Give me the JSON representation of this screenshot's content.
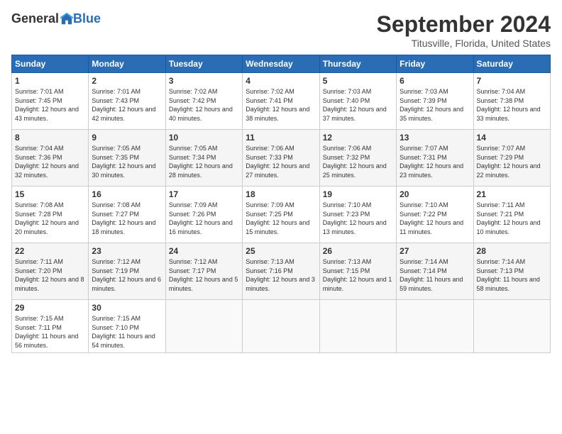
{
  "logo": {
    "general": "General",
    "blue": "Blue"
  },
  "header": {
    "month": "September 2024",
    "location": "Titusville, Florida, United States"
  },
  "days_of_week": [
    "Sunday",
    "Monday",
    "Tuesday",
    "Wednesday",
    "Thursday",
    "Friday",
    "Saturday"
  ],
  "weeks": [
    [
      {
        "day": "1",
        "sunrise": "7:01 AM",
        "sunset": "7:45 PM",
        "daylight": "12 hours and 43 minutes."
      },
      {
        "day": "2",
        "sunrise": "7:01 AM",
        "sunset": "7:43 PM",
        "daylight": "12 hours and 42 minutes."
      },
      {
        "day": "3",
        "sunrise": "7:02 AM",
        "sunset": "7:42 PM",
        "daylight": "12 hours and 40 minutes."
      },
      {
        "day": "4",
        "sunrise": "7:02 AM",
        "sunset": "7:41 PM",
        "daylight": "12 hours and 38 minutes."
      },
      {
        "day": "5",
        "sunrise": "7:03 AM",
        "sunset": "7:40 PM",
        "daylight": "12 hours and 37 minutes."
      },
      {
        "day": "6",
        "sunrise": "7:03 AM",
        "sunset": "7:39 PM",
        "daylight": "12 hours and 35 minutes."
      },
      {
        "day": "7",
        "sunrise": "7:04 AM",
        "sunset": "7:38 PM",
        "daylight": "12 hours and 33 minutes."
      }
    ],
    [
      {
        "day": "8",
        "sunrise": "7:04 AM",
        "sunset": "7:36 PM",
        "daylight": "12 hours and 32 minutes."
      },
      {
        "day": "9",
        "sunrise": "7:05 AM",
        "sunset": "7:35 PM",
        "daylight": "12 hours and 30 minutes."
      },
      {
        "day": "10",
        "sunrise": "7:05 AM",
        "sunset": "7:34 PM",
        "daylight": "12 hours and 28 minutes."
      },
      {
        "day": "11",
        "sunrise": "7:06 AM",
        "sunset": "7:33 PM",
        "daylight": "12 hours and 27 minutes."
      },
      {
        "day": "12",
        "sunrise": "7:06 AM",
        "sunset": "7:32 PM",
        "daylight": "12 hours and 25 minutes."
      },
      {
        "day": "13",
        "sunrise": "7:07 AM",
        "sunset": "7:31 PM",
        "daylight": "12 hours and 23 minutes."
      },
      {
        "day": "14",
        "sunrise": "7:07 AM",
        "sunset": "7:29 PM",
        "daylight": "12 hours and 22 minutes."
      }
    ],
    [
      {
        "day": "15",
        "sunrise": "7:08 AM",
        "sunset": "7:28 PM",
        "daylight": "12 hours and 20 minutes."
      },
      {
        "day": "16",
        "sunrise": "7:08 AM",
        "sunset": "7:27 PM",
        "daylight": "12 hours and 18 minutes."
      },
      {
        "day": "17",
        "sunrise": "7:09 AM",
        "sunset": "7:26 PM",
        "daylight": "12 hours and 16 minutes."
      },
      {
        "day": "18",
        "sunrise": "7:09 AM",
        "sunset": "7:25 PM",
        "daylight": "12 hours and 15 minutes."
      },
      {
        "day": "19",
        "sunrise": "7:10 AM",
        "sunset": "7:23 PM",
        "daylight": "12 hours and 13 minutes."
      },
      {
        "day": "20",
        "sunrise": "7:10 AM",
        "sunset": "7:22 PM",
        "daylight": "12 hours and 11 minutes."
      },
      {
        "day": "21",
        "sunrise": "7:11 AM",
        "sunset": "7:21 PM",
        "daylight": "12 hours and 10 minutes."
      }
    ],
    [
      {
        "day": "22",
        "sunrise": "7:11 AM",
        "sunset": "7:20 PM",
        "daylight": "12 hours and 8 minutes."
      },
      {
        "day": "23",
        "sunrise": "7:12 AM",
        "sunset": "7:19 PM",
        "daylight": "12 hours and 6 minutes."
      },
      {
        "day": "24",
        "sunrise": "7:12 AM",
        "sunset": "7:17 PM",
        "daylight": "12 hours and 5 minutes."
      },
      {
        "day": "25",
        "sunrise": "7:13 AM",
        "sunset": "7:16 PM",
        "daylight": "12 hours and 3 minutes."
      },
      {
        "day": "26",
        "sunrise": "7:13 AM",
        "sunset": "7:15 PM",
        "daylight": "12 hours and 1 minute."
      },
      {
        "day": "27",
        "sunrise": "7:14 AM",
        "sunset": "7:14 PM",
        "daylight": "11 hours and 59 minutes."
      },
      {
        "day": "28",
        "sunrise": "7:14 AM",
        "sunset": "7:13 PM",
        "daylight": "11 hours and 58 minutes."
      }
    ],
    [
      {
        "day": "29",
        "sunrise": "7:15 AM",
        "sunset": "7:11 PM",
        "daylight": "11 hours and 56 minutes."
      },
      {
        "day": "30",
        "sunrise": "7:15 AM",
        "sunset": "7:10 PM",
        "daylight": "11 hours and 54 minutes."
      },
      null,
      null,
      null,
      null,
      null
    ]
  ]
}
